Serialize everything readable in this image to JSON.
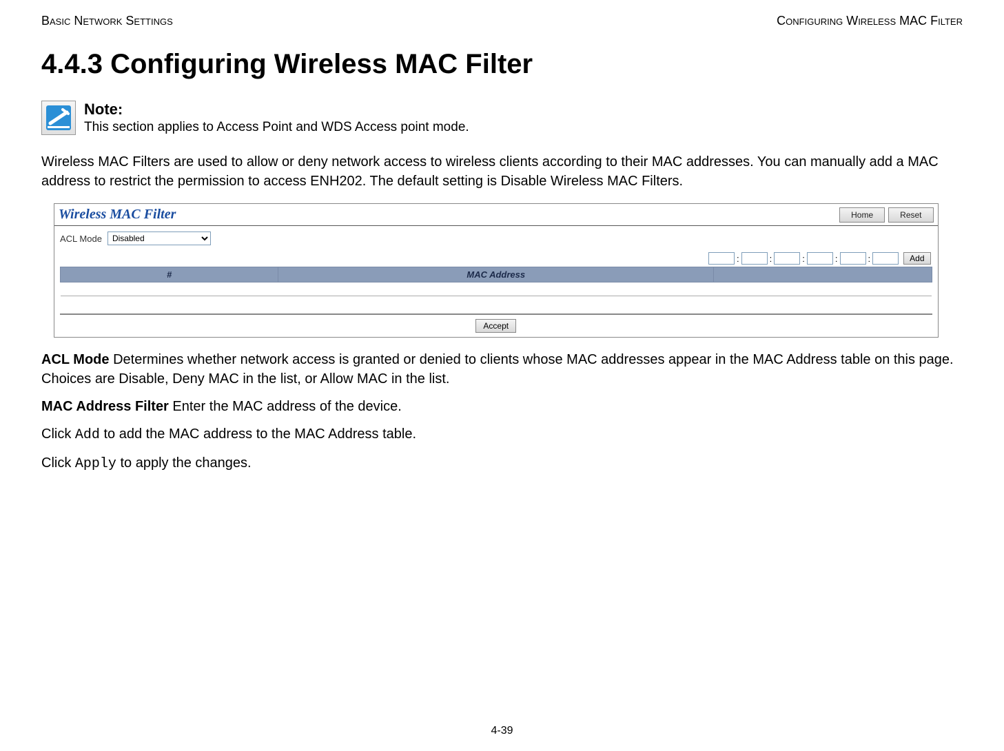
{
  "header": {
    "left": "Basic Network Settings",
    "right": "Configuring Wireless MAC Filter"
  },
  "section_title": "4.4.3 Configuring Wireless MAC Filter",
  "note": {
    "label": "Note:",
    "text": "This section applies to Access Point and WDS Access point mode."
  },
  "intro": "Wireless MAC Filters are used to allow or deny network access to wireless clients according to their MAC addresses. You can manually add a MAC address to restrict the permission to access ENH202. The default setting is Disable Wireless MAC Filters.",
  "screenshot": {
    "title": "Wireless MAC Filter",
    "home_btn": "Home",
    "reset_btn": "Reset",
    "acl_label": "ACL Mode",
    "acl_value": "Disabled",
    "add_btn": "Add",
    "table": {
      "col_num": "#",
      "col_mac": "MAC Address"
    },
    "accept_btn": "Accept"
  },
  "definitions": {
    "acl_mode": {
      "term": "ACL Mode",
      "text": "  Determines whether network access is granted or denied to clients whose MAC addresses appear in the MAC Address table on this page. Choices are Disable, Deny MAC in the list, or Allow MAC in the list."
    },
    "mac_filter": {
      "term": "MAC Address Filter",
      "text": "  Enter the MAC address of the device."
    },
    "add_line": {
      "prefix": "Click ",
      "code": "Add",
      "suffix": " to add the MAC address to the MAC Address table."
    },
    "apply_line": {
      "prefix": "Click ",
      "code": "Apply",
      "suffix": " to apply the changes."
    }
  },
  "page_number": "4-39"
}
